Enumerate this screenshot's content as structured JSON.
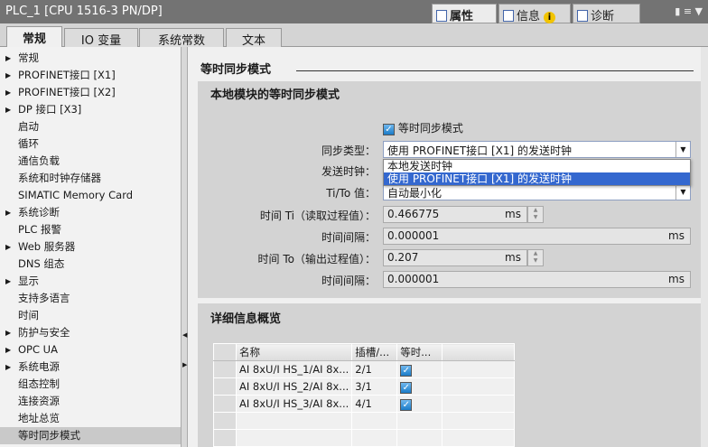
{
  "title": "PLC_1 [CPU 1516-3 PN/DP]",
  "panel_tabs": [
    {
      "label": "属性"
    },
    {
      "label": "信息"
    },
    {
      "label": "诊断"
    }
  ],
  "tabs": [
    "常规",
    "IO 变量",
    "系统常数",
    "文本"
  ],
  "nav": [
    "常规",
    "PROFINET接口 [X1]",
    "PROFINET接口 [X2]",
    "DP 接口 [X3]",
    "启动",
    "循环",
    "通信负载",
    "系统和时钟存储器",
    "SIMATIC Memory Card",
    "系统诊断",
    "PLC 报警",
    "Web 服务器",
    "DNS 组态",
    "显示",
    "支持多语言",
    "时间",
    "防护与安全",
    "OPC UA",
    "系统电源",
    "组态控制",
    "连接资源",
    "地址总览",
    "等时同步模式"
  ],
  "section_title": "等时同步模式",
  "local": {
    "title": "本地模块的等时同步模式",
    "iso_checkbox": "等时同步模式",
    "sync_type_label": "同步类型：",
    "sync_type_value": "使用 PROFINET接口 [X1] 的发送时钟",
    "send_clock_label": "发送时钟：",
    "tito_label": "Ti/To 值：",
    "tito_value": "自动最小化",
    "ti_label": "时间 Ti（读取过程值）：",
    "ti_value": "0.466775",
    "interval_label": "时间间隔：",
    "ti_interval": "0.000001",
    "to_label": "时间 To（输出过程值）：",
    "to_value": "0.207",
    "to_interval": "0.000001",
    "unit": "ms",
    "options": [
      "本地发送时钟",
      "使用 PROFINET接口 [X1] 的发送时钟"
    ]
  },
  "detail": {
    "title": "详细信息概览",
    "headers": [
      "名称",
      "插槽/...",
      "等时..."
    ],
    "rows": [
      {
        "name": "AI 8xU/I HS_1/AI 8x...",
        "slot": "2/1"
      },
      {
        "name": "AI 8xU/I HS_2/AI 8x...",
        "slot": "3/1"
      },
      {
        "name": "AI 8xU/I HS_3/AI 8x...",
        "slot": "4/1"
      }
    ]
  }
}
